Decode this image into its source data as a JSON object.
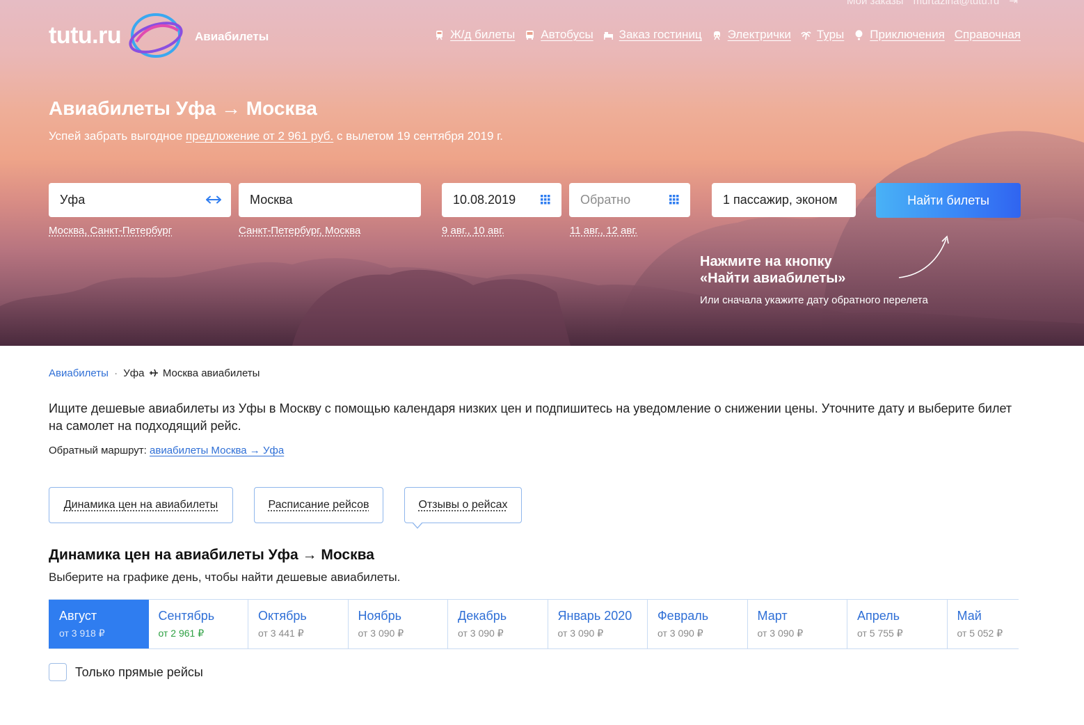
{
  "header": {
    "account": {
      "orders": "Мои заказы",
      "email": "murtazina@tutu.ru"
    },
    "logo_text": "tutu.ru",
    "section": "Авиабилеты",
    "nav": [
      {
        "label": "Ж/д билеты",
        "icon": "train-icon"
      },
      {
        "label": "Автобусы",
        "icon": "bus-icon"
      },
      {
        "label": "Заказ гостиниц",
        "icon": "bed-icon"
      },
      {
        "label": "Электрички",
        "icon": "suburban-train-icon"
      },
      {
        "label": "Туры",
        "icon": "palm-icon"
      },
      {
        "label": "Приключения",
        "icon": "balloon-icon"
      },
      {
        "label": "Справочная",
        "icon": ""
      }
    ]
  },
  "hero": {
    "title": "Авиабилеты Уфа → Москва",
    "subtitle_prefix": "Успей забрать выгодное ",
    "subtitle_link": "предложение от 2 961 руб.",
    "subtitle_suffix": " с вылетом 19 сентября 2019 г."
  },
  "search": {
    "from": "Уфа",
    "to": "Москва",
    "date_there": "10.08.2019",
    "date_back_placeholder": "Обратно",
    "passengers": "1 пассажир, эконом",
    "button": "Найти билеты",
    "hints": {
      "from": "Москва, Санкт-Петербург",
      "to": "Санкт-Петербург, Москва",
      "date_there": "9 авг., 10 авг.",
      "date_back": "11 авг., 12 авг."
    },
    "tip_title": "Нажмите на кнопку\n«Найти авиабилеты»",
    "tip_subtitle": "Или сначала укажите дату обратного перелета"
  },
  "breadcrumb": {
    "root": "Авиабилеты",
    "separator": "·",
    "from": "Уфа",
    "to_text": "Москва авиабилеты"
  },
  "intro": "Ищите дешевые авиабилеты из Уфы в Москву с помощью календаря низких цен и подпишитесь на уведомление о снижении цены. Уточните дату и выберите билет на самолет на подходящий рейс.",
  "return_route": {
    "label": "Обратный маршрут: ",
    "link": "авиабилеты Москва → Уфа"
  },
  "tabs": [
    {
      "label": "Динамика цен на авиабилеты"
    },
    {
      "label": "Расписание рейсов"
    },
    {
      "label": "Отзывы о рейсах"
    }
  ],
  "price_dynamics": {
    "title": "Динамика цен на авиабилеты Уфа → Москва",
    "subtitle": "Выберите на графике день, чтобы найти дешевые авиабилеты.",
    "months": [
      {
        "name": "Август",
        "price": "от 3 918 ₽"
      },
      {
        "name": "Сентябрь",
        "price": "от 2 961 ₽"
      },
      {
        "name": "Октябрь",
        "price": "от 3 441 ₽"
      },
      {
        "name": "Ноябрь",
        "price": "от 3 090 ₽"
      },
      {
        "name": "Декабрь",
        "price": "от 3 090 ₽"
      },
      {
        "name": "Январь 2020",
        "price": "от 3 090 ₽"
      },
      {
        "name": "Февраль",
        "price": "от 3 090 ₽"
      },
      {
        "name": "Март",
        "price": "от 3 090 ₽"
      },
      {
        "name": "Апрель",
        "price": "от 5 755 ₽"
      },
      {
        "name": "Май",
        "price": "от 5 052 ₽"
      }
    ],
    "direct_only": "Только прямые рейсы"
  },
  "colors": {
    "accent": "#2f7df0",
    "link": "#2f6fd6",
    "cheapest_price": "#2ea043",
    "button_gradient_start": "#49b2f6",
    "button_gradient_end": "#3064f0"
  }
}
